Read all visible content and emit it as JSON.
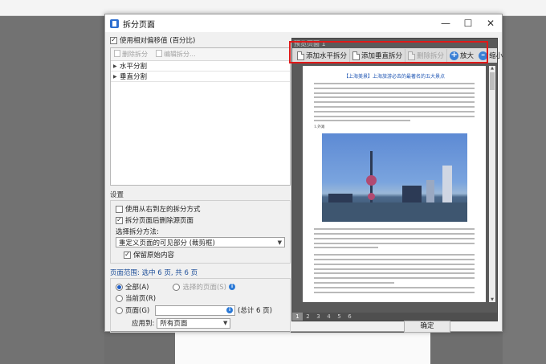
{
  "dialog": {
    "title": "拆分页面"
  },
  "left": {
    "use_relative_offset": "使用相对偏移值 (百分比)",
    "toolbar": {
      "delete_split": "删除拆分",
      "edit_split": "编辑拆分..."
    },
    "list_items": [
      "水平分割",
      "垂直分割"
    ]
  },
  "settings": {
    "label": "设置",
    "right_to_left": "使用从右到左的拆分方式",
    "delete_original": "拆分页面后删除源页面",
    "method_label": "选择拆分方法:",
    "method_value": "重定义页面的可见部分 (裁剪框)",
    "keep_content": "保留原始内容"
  },
  "range": {
    "label": "页面范围: 选中 6 页, 共 6 页",
    "all": "全部(A)",
    "selected_pages": "选择的页面(S)",
    "current": "当前页(R)",
    "pages": "页面(G)",
    "pages_total": "(总计 6 页)",
    "apply_label": "应用到:",
    "apply_value": "所有页面"
  },
  "preview": {
    "label": "预览页面 1",
    "add_horizontal": "添加水平拆分",
    "add_vertical": "添加垂直拆分",
    "delete_split": "删除拆分",
    "zoom_in": "放大",
    "zoom_out": "缩小",
    "doc_title": "【上海美景】上海旅游必去的最著名的五大景点",
    "doc_caption": "1.外滩",
    "page_numbers": [
      "1",
      "2",
      "3",
      "4",
      "5",
      "6"
    ]
  },
  "buttons": {
    "ok": "确定"
  },
  "colors": {
    "highlight": "#e01919",
    "accent": "#3a7fd5"
  }
}
